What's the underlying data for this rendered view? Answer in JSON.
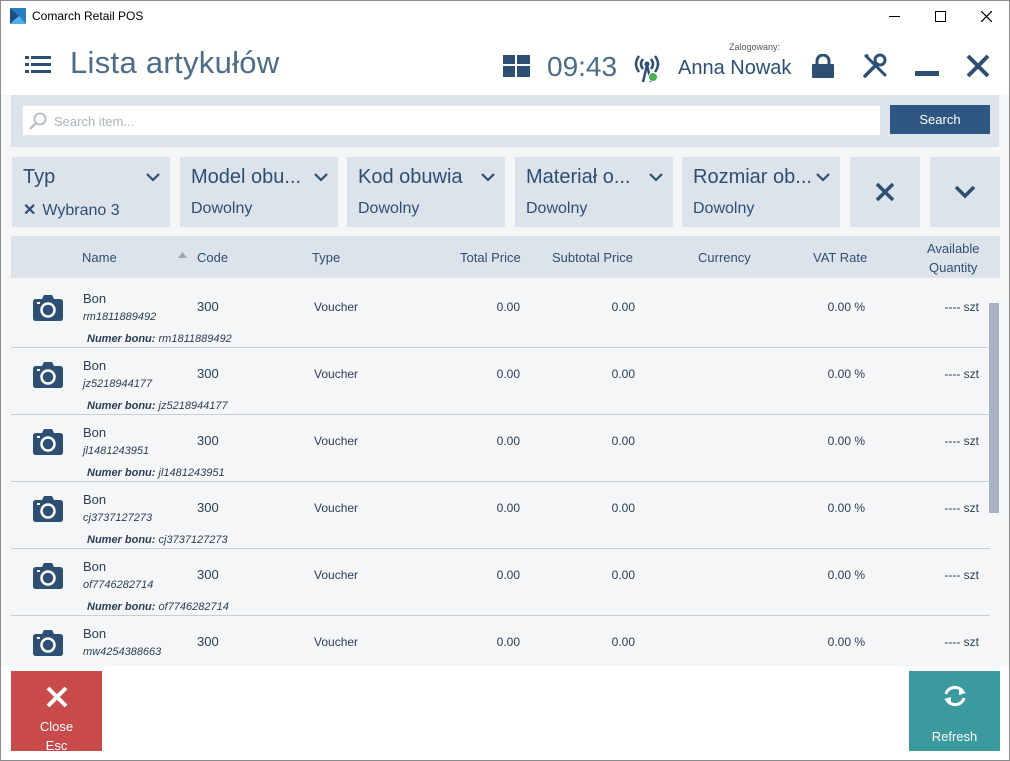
{
  "window": {
    "title": "Comarch Retail POS"
  },
  "header": {
    "title": "Lista artykułów",
    "time": "09:43",
    "logged_label": "Zalogowany:",
    "user": "Anna Nowak"
  },
  "search": {
    "placeholder": "Search item...",
    "button": "Search"
  },
  "filters": [
    {
      "title": "Typ",
      "value": "Wybrano 3",
      "has_clear": true
    },
    {
      "title": "Model obu...",
      "value": "Dowolny"
    },
    {
      "title": "Kod obuwia",
      "value": "Dowolny"
    },
    {
      "title": "Materiał o...",
      "value": "Dowolny"
    },
    {
      "title": "Rozmiar ob...",
      "value": "Dowolny"
    }
  ],
  "table": {
    "columns": [
      "Name",
      "Code",
      "Type",
      "Total Price",
      "Subtotal Price",
      "Currency",
      "VAT Rate",
      "Available",
      "Quantity"
    ],
    "bon_label": "Numer bonu:",
    "rows": [
      {
        "name": "Bon",
        "id": "rm1811889492",
        "code": "300",
        "type": "Voucher",
        "total": "0.00",
        "subtotal": "0.00",
        "vat": "0.00 %",
        "qty": "---- szt",
        "bon": "rm1811889492"
      },
      {
        "name": "Bon",
        "id": "jz5218944177",
        "code": "300",
        "type": "Voucher",
        "total": "0.00",
        "subtotal": "0.00",
        "vat": "0.00 %",
        "qty": "---- szt",
        "bon": "jz5218944177"
      },
      {
        "name": "Bon",
        "id": "jl1481243951",
        "code": "300",
        "type": "Voucher",
        "total": "0.00",
        "subtotal": "0.00",
        "vat": "0.00 %",
        "qty": "---- szt",
        "bon": "jl1481243951"
      },
      {
        "name": "Bon",
        "id": "cj3737127273",
        "code": "300",
        "type": "Voucher",
        "total": "0.00",
        "subtotal": "0.00",
        "vat": "0.00 %",
        "qty": "---- szt",
        "bon": "cj3737127273"
      },
      {
        "name": "Bon",
        "id": "of7746282714",
        "code": "300",
        "type": "Voucher",
        "total": "0.00",
        "subtotal": "0.00",
        "vat": "0.00 %",
        "qty": "---- szt",
        "bon": "of7746282714"
      },
      {
        "name": "Bon",
        "id": "mw4254388663",
        "code": "300",
        "type": "Voucher",
        "total": "0.00",
        "subtotal": "0.00",
        "vat": "0.00 %",
        "qty": "---- szt",
        "bon": "mw4254388663"
      }
    ]
  },
  "footer": {
    "close_label": "Close",
    "close_key": "Esc",
    "refresh_label": "Refresh"
  },
  "colors": {
    "primary": "#2f5680",
    "close": "#c94a4b",
    "refresh": "#3a9a9e",
    "panel": "#dde3ea",
    "online_dot": "#4caf50"
  }
}
